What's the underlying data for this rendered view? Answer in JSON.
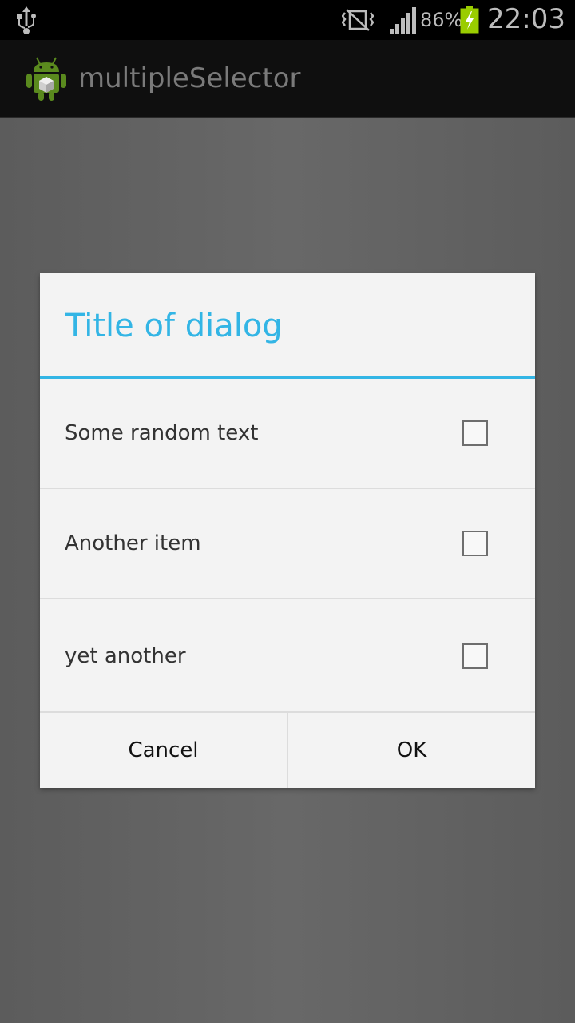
{
  "status_bar": {
    "battery_percent": "86%",
    "time": "22:03",
    "icons": [
      "usb-icon",
      "no-signal-vibrate-icon",
      "signal-icon",
      "battery-charging-icon"
    ]
  },
  "action_bar": {
    "app_title": "multipleSelector",
    "icon": "android-app-icon"
  },
  "dialog": {
    "title": "Title of dialog",
    "accent_color": "#33b5e5",
    "items": [
      {
        "label": "Some random text",
        "checked": false
      },
      {
        "label": "Another item",
        "checked": false
      },
      {
        "label": "yet another",
        "checked": false
      }
    ],
    "buttons": {
      "cancel": "Cancel",
      "ok": "OK"
    }
  }
}
